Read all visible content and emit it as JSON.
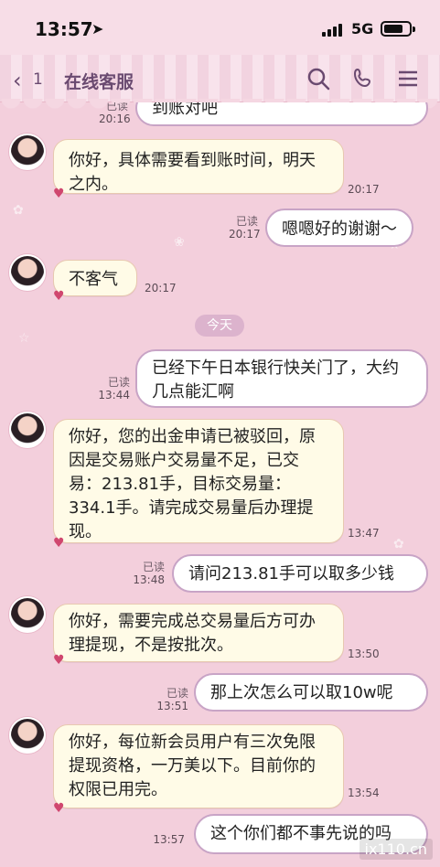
{
  "status": {
    "time": "13:57",
    "location_icon": "location-arrow-icon",
    "network": "5G",
    "battery_level": 0.65
  },
  "header": {
    "back_count": "1",
    "title": "在线客服"
  },
  "date_separator": "今天",
  "read_label": "已读",
  "messages": [
    {
      "side": "right",
      "text": "到账对吧",
      "time": "20:16",
      "read": true
    },
    {
      "side": "left",
      "text": "你好，具体需要看到账时间，明天之内。",
      "time": "20:17"
    },
    {
      "side": "right",
      "text": "嗯嗯好的谢谢～",
      "time": "20:17",
      "read": true
    },
    {
      "side": "left",
      "text": "不客气",
      "time": "20:17"
    },
    {
      "side": "right",
      "text": "已经下午日本银行快关门了，大约几点能汇啊",
      "time": "13:44",
      "read": true
    },
    {
      "side": "left",
      "text": "你好，您的出金申请已被驳回，原因是交易账户交易量不足，已交易：213.81手，目标交易量：334.1手。请完成交易量后办理提现。",
      "time": "13:47"
    },
    {
      "side": "right",
      "text": "请问213.81手可以取多少钱",
      "time": "13:48",
      "read": true
    },
    {
      "side": "left",
      "text": "你好，需要完成总交易量后方可办理提现，不是按批次。",
      "time": "13:50"
    },
    {
      "side": "right",
      "text": "那上次怎么可以取10w呢",
      "time": "13:51",
      "read": true
    },
    {
      "side": "left",
      "text": "你好，每位新会员用户有三次免限提现资格，一万美以下。目前你的权限已用完。",
      "time": "13:54"
    },
    {
      "side": "right",
      "text": "这个你们都不事先说的吗",
      "time": "13:57",
      "read": false
    }
  ],
  "watermark": "ix110.cn"
}
